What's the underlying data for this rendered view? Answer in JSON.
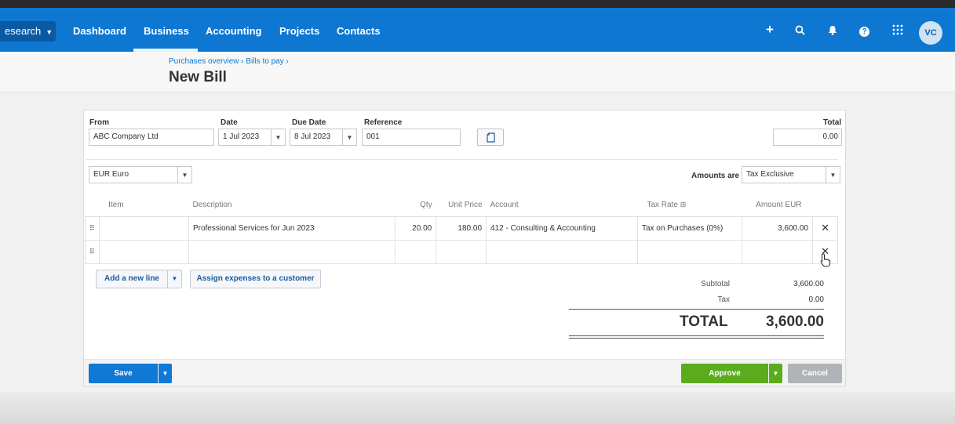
{
  "nav": {
    "org_label": "esearch",
    "items": [
      "Dashboard",
      "Business",
      "Accounting",
      "Projects",
      "Contacts"
    ],
    "active": "Business",
    "icons": [
      "plus-icon",
      "search-icon",
      "bell-icon",
      "help-icon",
      "apps-grid-icon"
    ],
    "plus_glyph": "+",
    "help_glyph": "?",
    "avatar": "VC",
    "color": "#0e77d2"
  },
  "header": {
    "breadcrumb": "Purchases overview › Bills to pay ›",
    "title": "New Bill"
  },
  "form": {
    "from_label": "From",
    "from_value": "ABC Company Ltd",
    "date_label": "Date",
    "date_value": "1 Jul 2023",
    "due_label": "Due Date",
    "due_value": "8 Jul 2023",
    "ref_label": "Reference",
    "ref_value": "001",
    "total_label": "Total",
    "total_value": "0.00",
    "currency": "EUR Euro",
    "amounts_are_label": "Amounts are",
    "amounts_are_value": "Tax Exclusive"
  },
  "table": {
    "headers": {
      "item": "Item",
      "description": "Description",
      "qty": "Qty",
      "unit_price": "Unit Price",
      "account": "Account",
      "tax_rate": "Tax Rate",
      "amount": "Amount EUR"
    },
    "rows": [
      {
        "item": "",
        "description": "Professional Services for Jun 2023",
        "qty": "20.00",
        "unit_price": "180.00",
        "account": "412 - Consulting & Accounting",
        "tax_rate": "Tax on Purchases (0%)",
        "amount": "3,600.00"
      },
      {
        "item": "",
        "description": "",
        "qty": "",
        "unit_price": "",
        "account": "",
        "tax_rate": "",
        "amount": ""
      }
    ]
  },
  "actions": {
    "add_line": "Add a new line",
    "assign": "Assign expenses to a customer"
  },
  "totals": {
    "subtotal_label": "Subtotal",
    "subtotal_value": "3,600.00",
    "tax_label": "Tax",
    "tax_value": "0.00",
    "total_label": "TOTAL",
    "total_value": "3,600.00"
  },
  "footer": {
    "save": "Save",
    "approve": "Approve",
    "cancel": "Cancel",
    "save_color": "#1078d5",
    "approve_color": "#5cab1d"
  }
}
